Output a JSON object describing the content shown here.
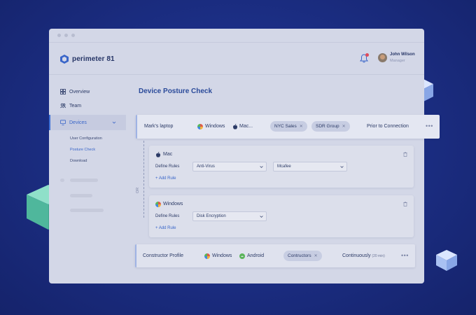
{
  "window": {
    "controls": [
      "close",
      "minimize",
      "maximize"
    ]
  },
  "brand": {
    "name": "perimeter 81",
    "logo_icon": "perimeter-logo-icon"
  },
  "header": {
    "notification_icon": "bell-icon",
    "user": {
      "name": "John Wilson",
      "role": "Manager"
    }
  },
  "sidebar": {
    "items": [
      {
        "label": "Overview",
        "icon": "grid-icon"
      },
      {
        "label": "Team",
        "icon": "users-icon"
      },
      {
        "label": "Devices",
        "icon": "monitor-icon",
        "active": true
      }
    ],
    "devices_subitems": [
      {
        "label": "User Configuration"
      },
      {
        "label": "Posture Check",
        "active": true
      },
      {
        "label": "Download"
      }
    ]
  },
  "main": {
    "title": "Device Posture Check",
    "profiles": [
      {
        "name": "Mark's laptop",
        "os": [
          "Windows",
          "Mac..."
        ],
        "groups": [
          "NYC Sales",
          "SDR Group"
        ],
        "timing": "Prior to Connection"
      },
      {
        "name": "Constructor Profile",
        "os": [
          "Windows",
          "Android"
        ],
        "groups": [
          "Contructors"
        ],
        "timing": "Continuously",
        "timing_note": "(20 min)"
      }
    ],
    "or_label": "OR",
    "rule_blocks": [
      {
        "os": "Mac",
        "define_label": "Define Rules",
        "selects": [
          "Anti-Virus",
          "Mcafee"
        ],
        "add_rule": "+ Add Rule"
      },
      {
        "os": "Windows",
        "define_label": "Define Rules",
        "selects": [
          "Disk Encryption"
        ],
        "add_rule": "+ Add Rule"
      }
    ]
  },
  "colors": {
    "background": "#1c2f86",
    "accent": "#3a66c9",
    "panel": "#d3d7e7",
    "cube_green": "#5fc6ad",
    "cube_blue": "#a9c1f2"
  }
}
